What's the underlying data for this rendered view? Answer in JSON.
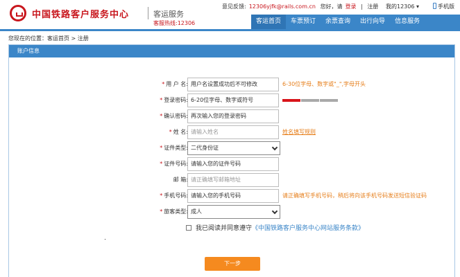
{
  "header": {
    "logo_text": "中国铁路客户服务中心",
    "logo_sub": "客运服务",
    "hotline": "客服热线:12306",
    "feedback_label": "意见反馈:",
    "feedback_email": "12306yjfk@rails.com.cn",
    "greeting": "您好，请",
    "login": "登录",
    "sep": "|",
    "register": "注册",
    "my12306": "我的12306 ▾",
    "phone": "手机版"
  },
  "nav": {
    "items": [
      "客运首页",
      "车票预订",
      "余票查询",
      "出行向导",
      "信息服务"
    ]
  },
  "breadcrumb": {
    "prefix": "您现在的位置：",
    "home": "客运首页",
    "sep": " > ",
    "current": "注册"
  },
  "panel": {
    "title": "账户信息"
  },
  "form": {
    "username": {
      "label": "用 户 名:",
      "value": "用户名设置成功后不可修改",
      "hint": "6-30位字母、数字或\"_\",字母开头"
    },
    "password": {
      "label": "登录密码:",
      "value": "6-20位字母、数字或符号"
    },
    "confirm": {
      "label": "确认密码:",
      "value": "再次输入您的登录密码"
    },
    "name": {
      "label": "姓  名:",
      "placeholder": "请输入姓名",
      "hint": "姓名填写规则"
    },
    "id_type": {
      "label": "证件类型:",
      "selected": "二代身份证"
    },
    "id_number": {
      "label": "证件号码:",
      "value": "请输入您的证件号码"
    },
    "email": {
      "label": "邮  箱:",
      "placeholder": "请正确填写邮箱地址"
    },
    "mobile": {
      "label": "手机号码:",
      "value": "请输入您的手机号码",
      "hint": "请正确填写手机号码，稍后将向该手机号码发送短信验证码"
    },
    "passenger_type": {
      "label": "旅客类型:",
      "selected": "成人"
    },
    "required_mark": "*",
    "password_strength": 0.33
  },
  "agreement": {
    "text": "我已阅读并同意遵守",
    "terms": "《中国铁路客户服务中心网站服务条款》"
  },
  "next_button": "下一步",
  "colors": {
    "brand_red": "#c8161d",
    "nav_blue": "#3b86c8",
    "hint_orange": "#e67e1a",
    "button_orange": "#f58a1f"
  }
}
